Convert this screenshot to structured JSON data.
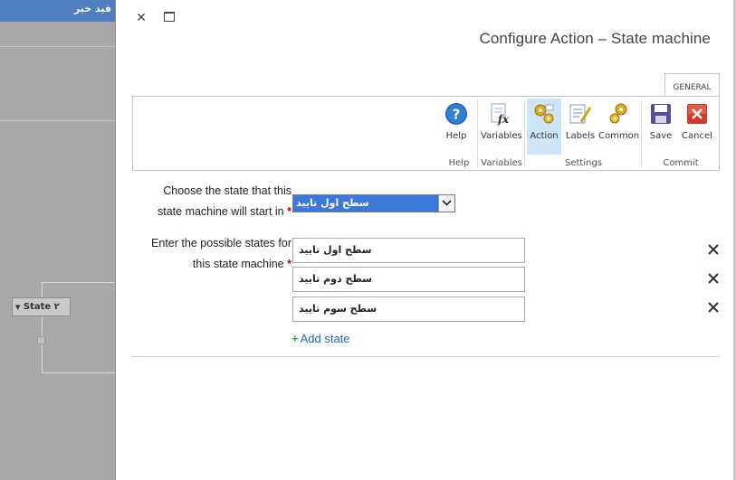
{
  "background": {
    "header_text": "فید خبر",
    "state_node_label": "State ۲"
  },
  "dialog": {
    "title": "Configure Action – State machine",
    "close_glyph": "✕",
    "ribbon_tab": "GENERAL",
    "ribbon": {
      "buttons": {
        "help": "Help",
        "variables": "Variables",
        "action": "Action",
        "labels": "Labels",
        "common": "Common",
        "save": "Save",
        "cancel": "Cancel"
      },
      "groups": {
        "help": "Help",
        "variables": "Variables",
        "settings": "Settings",
        "commit": "Commit"
      },
      "active_button": "action"
    },
    "form": {
      "start_state_label_line1": "Choose the state that this",
      "start_state_label_line2": "state machine will start in",
      "start_state_value": "سطح اول تایید",
      "states_label_line1": "Enter the possible states for",
      "states_label_line2": "this state machine",
      "required_mark": "*",
      "states": [
        "سطح اول تایید",
        "سطح دوم تایید",
        "سطح سوم تایید"
      ],
      "add_state_label": "Add state",
      "add_state_glyph": "+"
    },
    "colors": {
      "accent_select": "#3b78d8",
      "link": "#1e6bb8",
      "required": "#c00000",
      "active_ribbon": "#cde5f7"
    }
  }
}
